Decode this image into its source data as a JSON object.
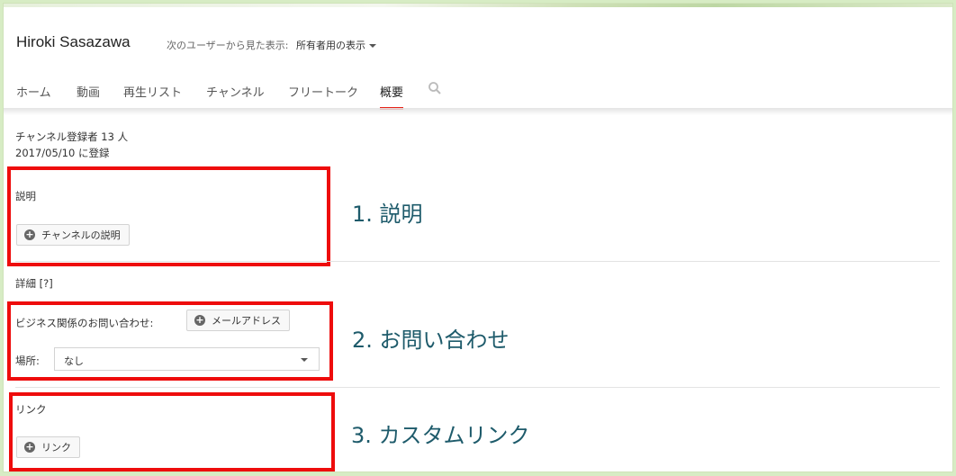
{
  "channel": {
    "name": "Hiroki Sasazawa",
    "view_as_label": "次のユーザーから見た表示:",
    "view_as_value": "所有者用の表示"
  },
  "tabs": [
    {
      "label": "ホーム"
    },
    {
      "label": "動画"
    },
    {
      "label": "再生リスト"
    },
    {
      "label": "チャンネル"
    },
    {
      "label": "フリートーク"
    },
    {
      "label": "概要"
    }
  ],
  "stats": {
    "subscribers": "チャンネル登録者 13 人",
    "joined": "2017/05/10 に登録"
  },
  "description": {
    "label": "説明",
    "button": "チャンネルの説明"
  },
  "details": {
    "label": "詳細 [?]",
    "business_label": "ビジネス関係のお問い合わせ:",
    "email_button": "メールアドレス",
    "location_label": "場所:",
    "location_value": "なし"
  },
  "links": {
    "label": "リンク",
    "button": "リンク"
  },
  "annotations": {
    "one": "1. 説明",
    "two": "2. お問い合わせ",
    "three": "3. カスタムリンク"
  },
  "colors": {
    "highlight": "#ee0c0c",
    "annotation_text": "#1e5b6b",
    "active_tab": "#e62117"
  }
}
